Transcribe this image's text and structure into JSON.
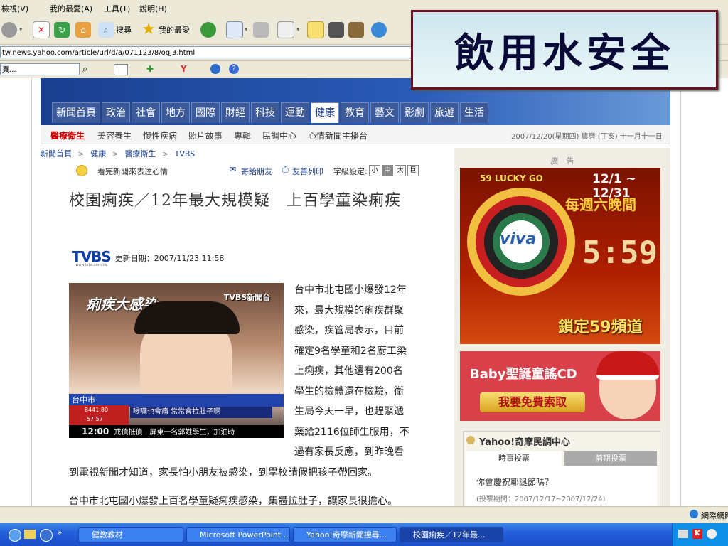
{
  "browser": {
    "menu": [
      "檢視(V)",
      "我的最愛(A)",
      "工具(T)",
      "說明(H)"
    ],
    "toolbar": {
      "search_label": "搜尋",
      "favorites_label": "我的最愛"
    },
    "address": "tw.news.yahoo.com/article/url/d/a/071123/8/oqj3.html",
    "search_partial": "頁..."
  },
  "overlay": {
    "title": "飲用水安全"
  },
  "site": {
    "nav_tabs": [
      "新聞首頁",
      "政治",
      "社會",
      "地方",
      "國際",
      "財經",
      "科技",
      "運動",
      "健康",
      "教育",
      "藝文",
      "影劇",
      "旅遊",
      "生活"
    ],
    "active_tab": "健康",
    "subnav": [
      "醫療衛生",
      "美容養生",
      "慢性疾病",
      "照片故事",
      "專輯",
      "民調中心",
      "心情新聞主播台"
    ],
    "date": "2007/12/20(星期四)  農曆 (丁亥) 十一月十一日",
    "breadcrumb": [
      "新聞首頁",
      "健康",
      "醫療衛生",
      "TVBS"
    ],
    "breadcrumb_sep": ">"
  },
  "article": {
    "mood": "看完新聞來表達心情",
    "send": "寄給朋友",
    "print": "友善列印",
    "fontsize_label": "字級設定:",
    "fontsizes": [
      "小",
      "中",
      "大",
      "巨"
    ],
    "headline": "校園痢疾／12年最大規模疑　上百學童染痢疾",
    "source": "TVBS",
    "source_url": "www.tvbs.com.tw",
    "updated": "更新日期：2007/11/23 11:58",
    "photo": {
      "caption_tag": "痢疾大感染",
      "channel": "TVBS新聞台",
      "location": "台中市",
      "crawl": "喉嚨也會痛 常常會拉肚子啊",
      "ticker_time": "12:00",
      "ticker_text": "戎債抵債｜屏東一名郭姓學生，加油時",
      "ticker_num1": "8441.80",
      "ticker_num2": "-57.57"
    },
    "body_lines": [
      "台中市北屯國小爆發12年",
      "來，最大規模的痢疾群聚",
      "感染，疾管局表示，目前",
      "確定9名學童和2名廚工染",
      "上痢疾，其他還有200名",
      "學生的檢體還在檢驗，衛",
      "生局今天一早，也趕緊遞",
      "藥給2116位師生服用，不",
      "過有家長反應，到昨晚看"
    ],
    "body_full": "到電視新聞才知道，家長怕小朋友被感染，到學校請假把孩子帶回家。",
    "body_cut": "台中市北屯國小爆發上百名學童疑痢疾感染，集體拉肚子，讓家長很擔心。"
  },
  "sidebar": {
    "ad_label": "廣　告",
    "ad1": {
      "dates": "12/1 ~ 12/31",
      "promo": "每週六晚間",
      "brand": "viva",
      "lucky": "59 LUCKY GO",
      "time": "5:59",
      "channel": "鎖定59頻道"
    },
    "ad2": {
      "title": "Baby聖誕童謠CD",
      "button": "我要免費索取"
    },
    "poll": {
      "title": "Yahoo!奇摩民調中心",
      "tabs": [
        "時事投票",
        "前期投票"
      ],
      "question": "你會慶祝耶誕節嗎？",
      "period": "(投票期間：2007/12/17~2007/12/24)"
    }
  },
  "statusbar": {
    "zone": "網際網路"
  },
  "taskbar": {
    "items": [
      "健教教材",
      "Microsoft PowerPoint ...",
      "Yahoo!奇摩新聞搜尋...",
      "校園痢疾／12年最..."
    ]
  }
}
